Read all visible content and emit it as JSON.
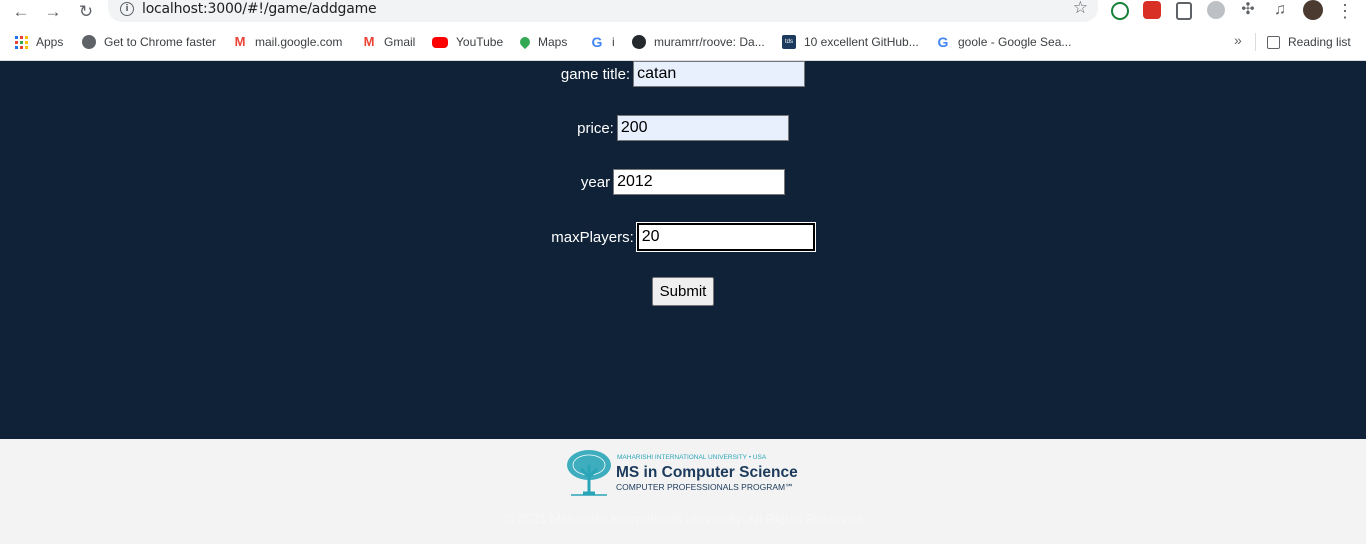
{
  "browser": {
    "url": "localhost:3000/#!/game/addgame",
    "bookmarks": [
      {
        "label": "Apps",
        "icon": "apps-grid-icon"
      },
      {
        "label": "Get to Chrome faster",
        "icon": "chrome-icon"
      },
      {
        "label": "mail.google.com",
        "icon": "gmail-icon"
      },
      {
        "label": "Gmail",
        "icon": "gmail-icon"
      },
      {
        "label": "YouTube",
        "icon": "youtube-icon"
      },
      {
        "label": "Maps",
        "icon": "maps-icon"
      },
      {
        "label": "i",
        "icon": "google-icon"
      },
      {
        "label": "muramrr/roove: Da...",
        "icon": "github-icon"
      },
      {
        "label": "10 excellent GitHub...",
        "icon": "tds-icon"
      },
      {
        "label": "goole - Google Sea...",
        "icon": "google-icon"
      }
    ],
    "reading_list": "Reading list",
    "more_bookmarks": "»"
  },
  "form": {
    "title_label": "game title:",
    "title_value": "catan",
    "price_label": "price:",
    "price_value": "200",
    "year_label": "year",
    "year_value": "2012",
    "max_label": "maxPlayers:",
    "max_value": "20",
    "submit_label": "Submit"
  },
  "footer": {
    "logo_line1": "MAHARISHI INTERNATIONAL UNIVERSITY • USA",
    "logo_line2": "MS in Computer Science",
    "logo_line3": "COMPUTER PROFESSIONALS PROGRAM℠",
    "copyright": "© 2021 Maharishi International University. All Rights Reserved"
  },
  "colors": {
    "page_background": "#0f2237",
    "footer_background": "#f3f3f3",
    "autofill_background": "#e8f0fe",
    "logo_teal": "#2aa5b8",
    "logo_navy": "#1b3a5c"
  }
}
